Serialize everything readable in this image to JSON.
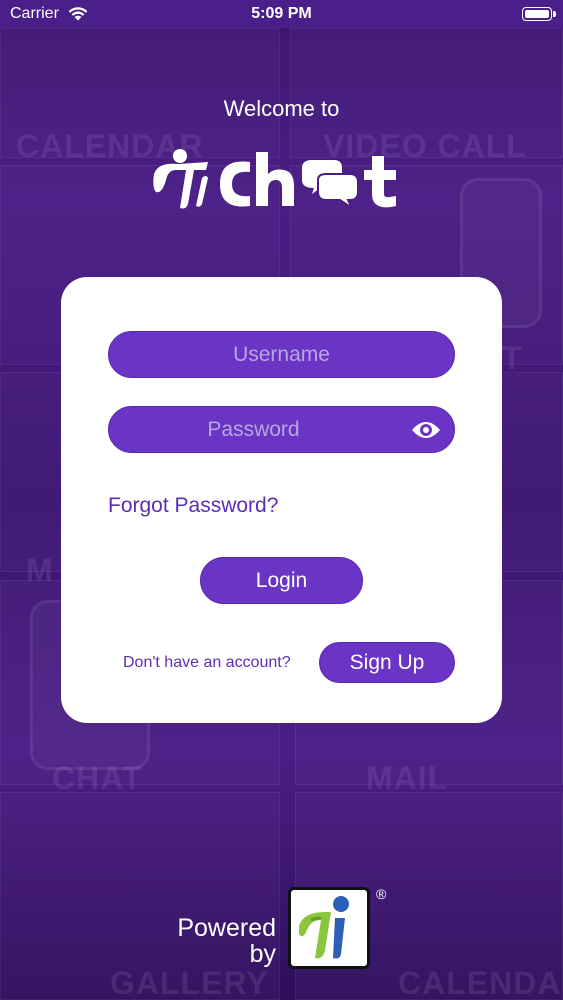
{
  "status_bar": {
    "carrier": "Carrier",
    "time": "5:09 PM"
  },
  "background_words": [
    "CALENDAR",
    "VIDEO CALL",
    "CHAT",
    "MAIL",
    "GALLERY",
    "CALENDAR",
    "M",
    "T"
  ],
  "header": {
    "welcome": "Welcome to",
    "logo_text": "PiChat"
  },
  "login_form": {
    "username_placeholder": "Username",
    "password_placeholder": "Password",
    "forgot_password": "Forgot Password?",
    "login_label": "Login",
    "no_account_text": "Don't have an account?",
    "signup_label": "Sign Up"
  },
  "footer": {
    "powered": "Powered",
    "by": "by",
    "registered": "®"
  },
  "colors": {
    "accent": "#6a35c4",
    "link": "#5d2db5",
    "background": "#3d1670"
  },
  "icons": {
    "password_toggle": "eye-icon",
    "wifi": "wifi-icon",
    "battery": "battery-icon"
  }
}
